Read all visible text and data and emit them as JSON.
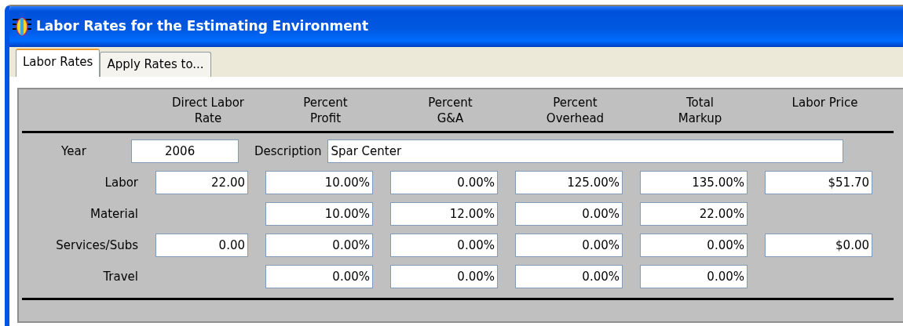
{
  "window": {
    "title": "Labor Rates for the Estimating Environment"
  },
  "tabs": [
    {
      "label": "Labor Rates",
      "selected": true
    },
    {
      "label": "Apply Rates to...",
      "selected": false
    }
  ],
  "columns": [
    "Direct Labor\nRate",
    "Percent\nProfit",
    "Percent\nG&A",
    "Percent\nOverhead",
    "Total\nMarkup",
    "Labor Price"
  ],
  "year": {
    "label": "Year",
    "value": "2006"
  },
  "description": {
    "label": "Description",
    "value": "Spar Center"
  },
  "rows": [
    {
      "label": "Labor",
      "cells": [
        "22.00",
        "10.00%",
        "0.00%",
        "125.00%",
        "135.00%",
        "$51.70"
      ]
    },
    {
      "label": "Material",
      "cells": [
        null,
        "10.00%",
        "12.00%",
        "0.00%",
        "22.00%",
        null
      ]
    },
    {
      "label": "Services/Subs",
      "cells": [
        "0.00",
        "0.00%",
        "0.00%",
        "0.00%",
        "0.00%",
        "$0.00"
      ]
    },
    {
      "label": "Travel",
      "cells": [
        null,
        "0.00%",
        "0.00%",
        "0.00%",
        "0.00%",
        null
      ]
    }
  ]
}
